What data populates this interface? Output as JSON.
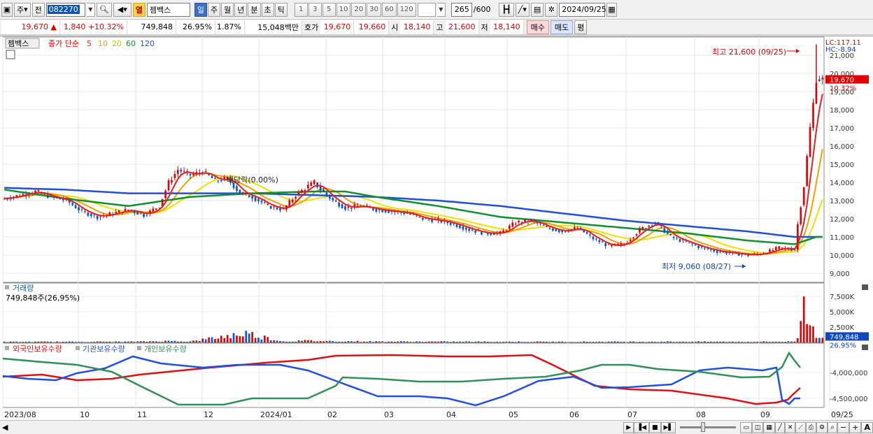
{
  "toolbar": {
    "period_day": "주",
    "prev_label": "전",
    "stock_code": "082270",
    "sector_badge": "열",
    "stock_name": "젬백스",
    "period_buttons": [
      "일",
      "주",
      "월",
      "년",
      "분",
      "초",
      "틱"
    ],
    "active_period": "일",
    "interval_buttons": [
      "1",
      "3",
      "5",
      "10",
      "20",
      "30",
      "60",
      "120"
    ],
    "bar_count": "265",
    "bar_total": "/600",
    "date": "2024/09/25"
  },
  "quote": {
    "price": "19,670",
    "up_arrow": "▲",
    "change": "1,840",
    "change_pct": "+10.32%",
    "volume": "749,848",
    "volume_pct": "26.95%",
    "turnover": "1.87%",
    "amount": "15,048백만",
    "ask_label": "호가",
    "ask": "19,670",
    "bid": "19,660",
    "open_label": "시",
    "open": "18,140",
    "high_label": "고",
    "high": "21,600",
    "low_label": "저",
    "low": "18,140",
    "buy_label": "매수",
    "sell_label": "매도",
    "eval_label": "평"
  },
  "colors": {
    "up": "#e00000",
    "down": "#0b52d0",
    "ma5": "#e02020",
    "ma10": "#f0a000",
    "ma20": "#f0e000",
    "ma60": "#109030",
    "ma120": "#2050d8",
    "foreign": "#e01010",
    "institution": "#2050e0",
    "individual": "#30905a"
  },
  "chart_data": {
    "type": "line",
    "price_panel": {
      "stock_label": "젬백스",
      "legend_prefix": "종가 단순",
      "ma_periods": [
        "5",
        "10",
        "20",
        "60",
        "120"
      ],
      "lc": "LC:117.11",
      "hc": "HC:-8.94",
      "ylim": [
        8500,
        22000
      ],
      "y_ticks": [
        9000,
        10000,
        11000,
        12000,
        13000,
        14000,
        15000,
        16000,
        17000,
        18000,
        19000,
        20000,
        21000
      ],
      "y_tick_labels": [
        "9,000",
        "10,000",
        "11,000",
        "12,000",
        "13,000",
        "14,000",
        "15,000",
        "16,000",
        "17,000",
        "18,000",
        "19,000",
        "20,000",
        "21,000"
      ],
      "current_price": "19,670",
      "current_pct": "10.32%",
      "high_note": "최고 21,600 (09/25)",
      "low_note": "최저 9,060 (08/27)",
      "dividend_note": "배당락(0.00%)",
      "close": [
        [
          0,
          13100
        ],
        [
          5,
          13300
        ],
        [
          10,
          13500
        ],
        [
          15,
          13200
        ],
        [
          20,
          13000
        ],
        [
          25,
          12400
        ],
        [
          30,
          12100
        ],
        [
          35,
          12300
        ],
        [
          40,
          12500
        ],
        [
          45,
          12200
        ],
        [
          50,
          12700
        ],
        [
          53,
          14000
        ],
        [
          56,
          14700
        ],
        [
          60,
          14400
        ],
        [
          64,
          14600
        ],
        [
          68,
          14100
        ],
        [
          72,
          14200
        ],
        [
          76,
          13400
        ],
        [
          80,
          13200
        ],
        [
          85,
          12700
        ],
        [
          90,
          12500
        ],
        [
          94,
          13300
        ],
        [
          98,
          13800
        ],
        [
          100,
          14000
        ],
        [
          102,
          13600
        ],
        [
          106,
          13000
        ],
        [
          110,
          12600
        ],
        [
          115,
          12700
        ],
        [
          120,
          12500
        ],
        [
          125,
          12400
        ],
        [
          130,
          12300
        ],
        [
          135,
          12000
        ],
        [
          140,
          11900
        ],
        [
          145,
          11700
        ],
        [
          150,
          11400
        ],
        [
          155,
          11200
        ],
        [
          160,
          11200
        ],
        [
          165,
          11800
        ],
        [
          170,
          11900
        ],
        [
          175,
          11500
        ],
        [
          180,
          11300
        ],
        [
          185,
          11500
        ],
        [
          190,
          10900
        ],
        [
          195,
          10500
        ],
        [
          200,
          10600
        ],
        [
          205,
          11400
        ],
        [
          210,
          11800
        ],
        [
          215,
          11000
        ],
        [
          220,
          10700
        ],
        [
          225,
          10400
        ],
        [
          230,
          10200
        ],
        [
          235,
          10100
        ],
        [
          240,
          10000
        ],
        [
          245,
          10100
        ],
        [
          250,
          10400
        ],
        [
          255,
          10300
        ],
        [
          256,
          11700
        ],
        [
          258,
          13800
        ],
        [
          260,
          17000
        ],
        [
          262,
          19670
        ]
      ],
      "ma60": [
        [
          0,
          13600
        ],
        [
          20,
          13100
        ],
        [
          40,
          12700
        ],
        [
          60,
          13200
        ],
        [
          80,
          13400
        ],
        [
          100,
          13500
        ],
        [
          110,
          13500
        ],
        [
          120,
          13200
        ],
        [
          140,
          12700
        ],
        [
          160,
          12100
        ],
        [
          180,
          11800
        ],
        [
          200,
          11500
        ],
        [
          220,
          11200
        ],
        [
          240,
          10800
        ],
        [
          255,
          10600
        ],
        [
          262,
          11000
        ]
      ],
      "ma120": [
        [
          0,
          13700
        ],
        [
          20,
          13600
        ],
        [
          40,
          13400
        ],
        [
          60,
          13400
        ],
        [
          80,
          13400
        ],
        [
          100,
          13300
        ],
        [
          120,
          13200
        ],
        [
          140,
          13000
        ],
        [
          160,
          12700
        ],
        [
          180,
          12300
        ],
        [
          200,
          11900
        ],
        [
          220,
          11600
        ],
        [
          240,
          11300
        ],
        [
          255,
          11000
        ],
        [
          262,
          11000
        ]
      ]
    },
    "volume_panel": {
      "title": "거래량",
      "current_label": "749,848주(26,95%)",
      "ylim": [
        0,
        9000
      ],
      "y_ticks": [
        2500,
        5000,
        7500
      ],
      "y_tick_labels": [
        "2,500K",
        "5,000K",
        "7,500K"
      ],
      "current_value": "749,848",
      "current_pct": "26.95%",
      "volume_k": [
        [
          0,
          110
        ],
        [
          20,
          120
        ],
        [
          40,
          130
        ],
        [
          56,
          250
        ],
        [
          60,
          160
        ],
        [
          78,
          1500
        ],
        [
          90,
          180
        ],
        [
          98,
          300
        ],
        [
          100,
          250
        ],
        [
          120,
          160
        ],
        [
          140,
          140
        ],
        [
          160,
          130
        ],
        [
          180,
          120
        ],
        [
          200,
          130
        ],
        [
          220,
          140
        ],
        [
          240,
          120
        ],
        [
          255,
          150
        ],
        [
          256,
          700
        ],
        [
          257,
          3500
        ],
        [
          258,
          7500
        ],
        [
          259,
          3000
        ],
        [
          260,
          2800
        ],
        [
          261,
          2600
        ],
        [
          262,
          750
        ]
      ]
    },
    "ownership_panel": {
      "series_names": [
        "외국인보유수량",
        "기관보유수량",
        "개인보유수량"
      ],
      "y_ticks": [
        -4000000,
        -4500000
      ],
      "y_tick_labels": [
        "-4,000,000",
        "-4,500,000"
      ]
    },
    "x_labels": [
      "2023/08",
      "10",
      "11",
      "12",
      "2024/01",
      "02",
      "03",
      "04",
      "05",
      "06",
      "07",
      "08",
      "09",
      "09/25"
    ]
  }
}
